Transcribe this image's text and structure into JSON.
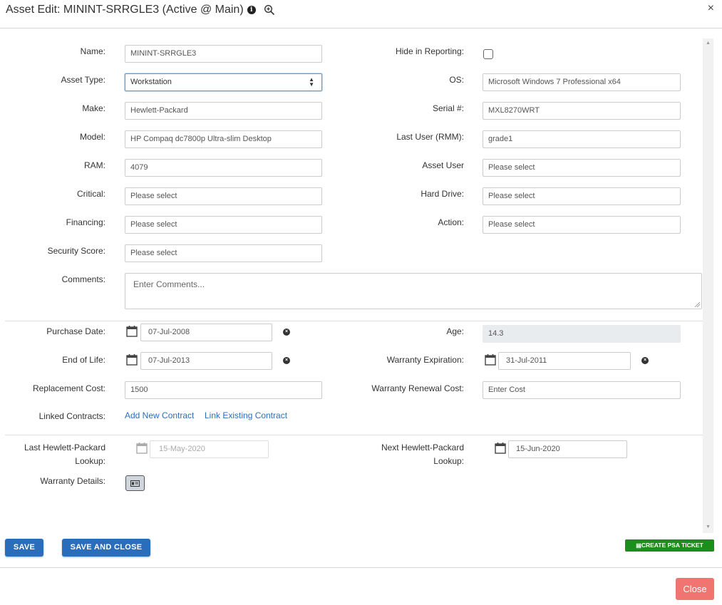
{
  "header": {
    "title": "Asset Edit: MININT-SRRGLE3 (Active @ Main)",
    "info_icon": "info-icon",
    "zoom_icon": "zoom-in-icon",
    "close_icon": "close-icon",
    "close_glyph": "×"
  },
  "form": {
    "name": {
      "label": "Name:",
      "value": "MININT-SRRGLE3"
    },
    "hide_in_reporting": {
      "label": "Hide in Reporting:",
      "checked": false
    },
    "asset_type": {
      "label": "Asset Type:",
      "value": "Workstation"
    },
    "os": {
      "label": "OS:",
      "value": "Microsoft Windows 7 Professional x64"
    },
    "make": {
      "label": "Make:",
      "value": "Hewlett-Packard"
    },
    "serial": {
      "label": "Serial #:",
      "value": "MXL8270WRT"
    },
    "model": {
      "label": "Model:",
      "value": "HP Compaq dc7800p Ultra-slim Desktop"
    },
    "last_user": {
      "label": "Last User (RMM):",
      "value": "grade1"
    },
    "ram": {
      "label": "RAM:",
      "value": "4079"
    },
    "asset_user": {
      "label": "Asset User",
      "placeholder": "Please select"
    },
    "critical": {
      "label": "Critical:",
      "placeholder": "Please select"
    },
    "hard_drive": {
      "label": "Hard Drive:",
      "placeholder": "Please select"
    },
    "financing": {
      "label": "Financing:",
      "placeholder": "Please select"
    },
    "action": {
      "label": "Action:",
      "placeholder": "Please select"
    },
    "security_score": {
      "label": "Security Score:",
      "placeholder": "Please select"
    },
    "comments": {
      "label": "Comments:",
      "placeholder": "Enter Comments..."
    },
    "purchase_date": {
      "label": "Purchase Date:",
      "value": "07-Jul-2008"
    },
    "age": {
      "label": "Age:",
      "value": "14.3"
    },
    "end_of_life": {
      "label": "End of Life:",
      "value": "07-Jul-2013"
    },
    "warranty_expiration": {
      "label": "Warranty Expiration:",
      "value": "31-Jul-2011"
    },
    "replacement_cost": {
      "label": "Replacement Cost:",
      "value": "1500"
    },
    "warranty_renewal_cost": {
      "label": "Warranty Renewal Cost:",
      "placeholder": "Enter Cost"
    },
    "linked_contracts": {
      "label": "Linked Contracts:",
      "add_new": "Add New Contract",
      "link_existing": "Link Existing Contract"
    },
    "last_lookup": {
      "label_line1": "Last Hewlett-Packard",
      "label_line2": "Lookup:",
      "value": "15-May-2020"
    },
    "next_lookup": {
      "label_line1": "Next Hewlett-Packard",
      "label_line2": "Lookup:",
      "value": "15-Jun-2020"
    },
    "warranty_details": {
      "label": "Warranty Details:"
    }
  },
  "footer": {
    "save": "SAVE",
    "save_and_close": "SAVE AND CLOSE",
    "create_psa_ticket": "CREATE PSA TICKET",
    "close": "Close"
  },
  "colors": {
    "primary": "#2a6ebb",
    "psa_green": "#1a8f1a",
    "close_red": "#f07470",
    "link": "#2a6ebb"
  }
}
